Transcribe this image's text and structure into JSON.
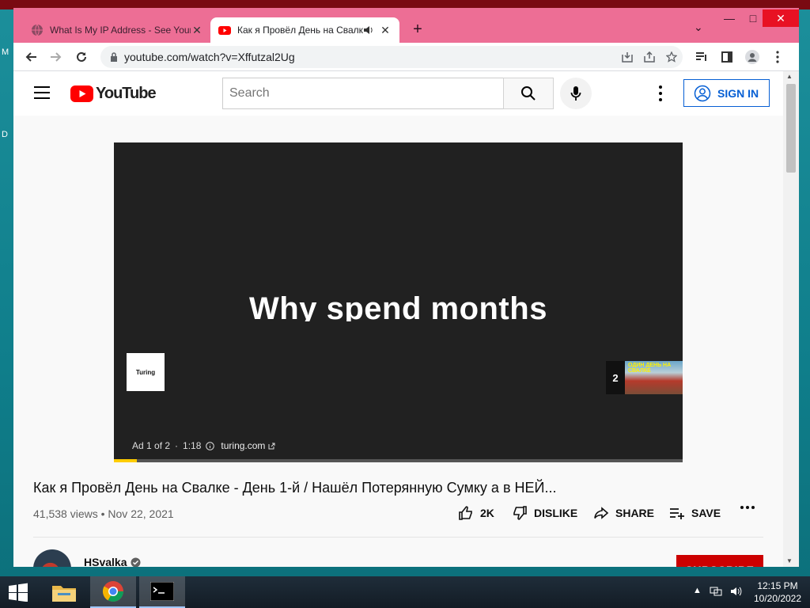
{
  "desktop": {
    "side_letters": [
      "M",
      "D"
    ]
  },
  "browser": {
    "tabs": [
      {
        "title": "What Is My IP Address - See Your",
        "active": false
      },
      {
        "title": "Как я Провёл День на Свалке",
        "active": true
      }
    ],
    "url": "youtube.com/watch?v=Xffutzal2Ug"
  },
  "youtube": {
    "logo_text": "YouTube",
    "search_placeholder": "Search",
    "sign_in": "SIGN IN",
    "ad_headline": "Why spend months",
    "ad_brand_logo": "Turing",
    "ad_label": "Ad 1 of 2",
    "ad_duration": "1:18",
    "ad_link": "turing.com",
    "ad_progress": 0.04,
    "next_ad_number": "2",
    "next_thumb_text": "ОДИН ДЕНЬ НА СВАЛКЕ",
    "video_title": "Как я Провёл День на Свалке - День 1-й / Нашёл Потерянную Сумку а в НЕЙ...",
    "views": "41,538 views",
    "date": "Nov 22, 2021",
    "likes": "2K",
    "dislike": "DISLIKE",
    "share": "SHARE",
    "save": "SAVE",
    "channel": "HSvalka",
    "subscribe": "SUBSCRIBE"
  },
  "taskbar": {
    "time": "12:15 PM",
    "date": "10/20/2022"
  },
  "colors": {
    "frame": "#ed6e95",
    "yt_red": "#ff0000",
    "accent_blue": "#065fd4"
  }
}
